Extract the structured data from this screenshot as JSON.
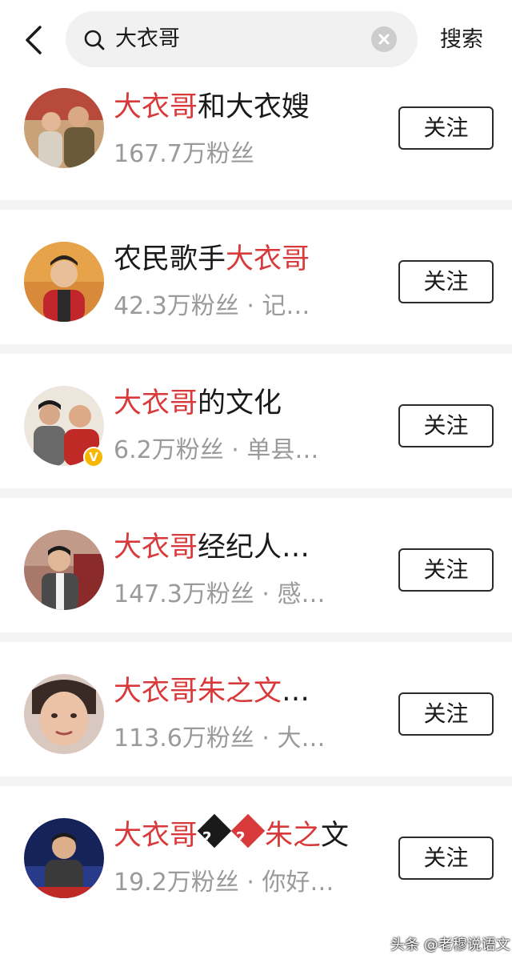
{
  "header": {
    "back_icon": "chevron-left-icon",
    "search_query": "大衣哥",
    "search_action_label": "搜索"
  },
  "results": [
    {
      "name_highlight": "大衣哥",
      "name_rest": "和大衣嫂",
      "meta": "167.7万粉丝",
      "follow_label": "关注",
      "avatar_colors": [
        "#b25a3a",
        "#6b5a3a"
      ]
    },
    {
      "name_prefix": "农民歌手",
      "name_highlight": "大衣哥",
      "meta": "42.3万粉丝 · 记…",
      "follow_label": "关注",
      "avatar_colors": [
        "#c9773a",
        "#b8202a"
      ]
    },
    {
      "name_highlight": "大衣哥",
      "name_rest": "的文化",
      "meta": "6.2万粉丝 · 单县…",
      "follow_label": "关注",
      "verified": true,
      "verified_icon": "v-badge-icon",
      "avatar_colors": [
        "#7a7a7a",
        "#c02a26"
      ]
    },
    {
      "name_highlight": "大衣哥",
      "name_rest": "经纪人…",
      "meta": "147.3万粉丝 · 感…",
      "follow_label": "关注",
      "avatar_colors": [
        "#8a5a4a",
        "#444444"
      ]
    },
    {
      "name_highlight": "大衣哥朱之文",
      "name_rest": "…",
      "meta": "113.6万粉丝 · 大…",
      "follow_label": "关注",
      "avatar_colors": [
        "#e8c8b0",
        "#b07060"
      ]
    },
    {
      "name_highlight": "大衣哥",
      "name_glyphs": [
        "?",
        "?"
      ],
      "name_highlight2": "朱之",
      "name_rest": "文",
      "meta": "19.2万粉丝 · 你好…",
      "follow_label": "关注",
      "avatar_colors": [
        "#1a2a6a",
        "#3a3a3a"
      ]
    }
  ],
  "watermark": "头条 @老穆说语文",
  "colors": {
    "highlight": "#d8393a",
    "meta_gray": "#9a9a9a",
    "verified": "#f5b700"
  }
}
